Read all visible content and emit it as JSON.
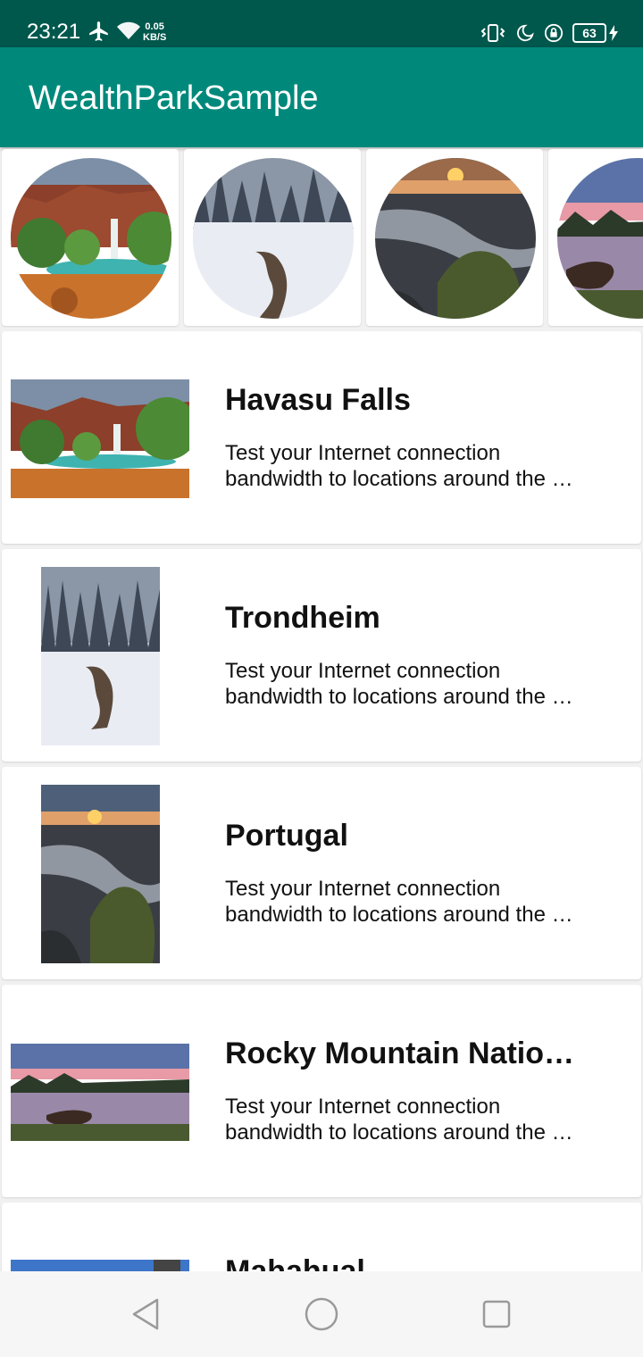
{
  "status_bar": {
    "time": "23:21",
    "net_speed_value": "0.05",
    "net_speed_unit": "KB/S",
    "battery_level": "63",
    "icons": [
      "airplane-icon",
      "wifi-icon",
      "vibrate-icon",
      "moon-icon",
      "lock-rotation-icon",
      "battery-icon",
      "charging-icon"
    ]
  },
  "app_bar": {
    "title": "WealthParkSample"
  },
  "carousel": {
    "items": [
      {
        "image": "havasu-falls-photo"
      },
      {
        "image": "trondheim-photo"
      },
      {
        "image": "portugal-photo"
      },
      {
        "image": "rocky-mountain-photo"
      }
    ]
  },
  "list": {
    "items": [
      {
        "title": "Havasu Falls",
        "desc_line1": "Test your Internet connection",
        "desc_line2": "bandwidth to locations around the …"
      },
      {
        "title": "Trondheim",
        "desc_line1": "Test your Internet connection",
        "desc_line2": "bandwidth to locations around the …"
      },
      {
        "title": "Portugal",
        "desc_line1": "Test your Internet connection",
        "desc_line2": "bandwidth to locations around the …"
      },
      {
        "title": "Rocky Mountain Nation…",
        "desc_line1": "Test your Internet connection",
        "desc_line2": "bandwidth to locations around the …"
      },
      {
        "title": "Mahahual"
      }
    ]
  },
  "nav_bar": {
    "icons": [
      "back-icon",
      "home-icon",
      "recents-icon"
    ]
  },
  "colors": {
    "status_bar": "#00574c",
    "app_bar": "#00897b",
    "background": "#f1f1f1"
  }
}
